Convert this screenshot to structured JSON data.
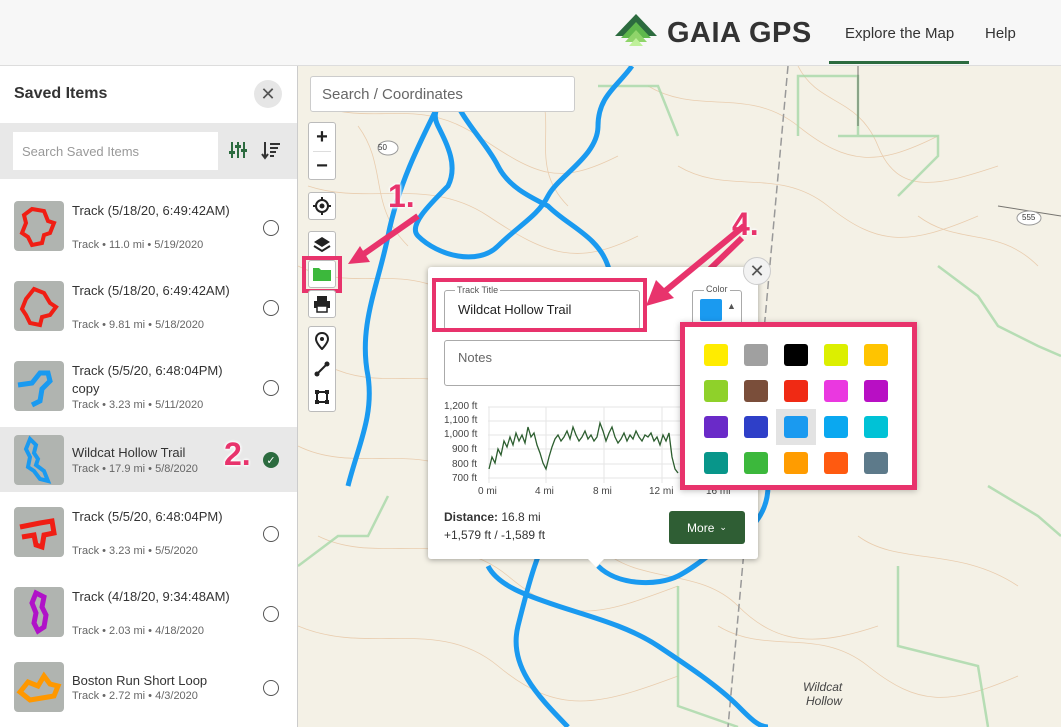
{
  "header": {
    "brand": "GAIA GPS",
    "nav": {
      "explore": "Explore the Map",
      "help": "Help"
    },
    "colors": {
      "brand_green": "#2c6b3f"
    }
  },
  "sidebar": {
    "title": "Saved Items",
    "close_icon": "close-icon",
    "search_placeholder": "Search Saved Items",
    "items": [
      {
        "title": "Track (5/18/20, 6:49:42AM)",
        "meta": "Track • 11.0 mi • 5/19/2020",
        "color": "#f01e14",
        "selected": false
      },
      {
        "title": "Track (5/18/20, 6:49:42AM)",
        "meta": "Track • 9.81 mi • 5/18/2020",
        "color": "#f01e14",
        "selected": false
      },
      {
        "title": "Track (5/5/20, 6:48:04PM) copy",
        "meta": "Track • 3.23 mi • 5/11/2020",
        "color": "#1a9af0",
        "selected": false
      },
      {
        "title": "Wildcat Hollow Trail",
        "meta": "Track • 17.9 mi • 5/8/2020",
        "color": "#1a9af0",
        "selected": true
      },
      {
        "title": "Track (5/5/20, 6:48:04PM)",
        "meta": "Track • 3.23 mi • 5/5/2020",
        "color": "#f01e14",
        "selected": false
      },
      {
        "title": "Track (4/18/20, 9:34:48AM)",
        "meta": "Track • 2.03 mi • 4/18/2020",
        "color": "#b012c8",
        "selected": false
      },
      {
        "title": "Boston Run Short Loop",
        "meta": "Track • 2.72 mi • 4/3/2020",
        "color": "#ff9800",
        "selected": false
      }
    ]
  },
  "map": {
    "search_placeholder": "Search / Coordinates",
    "road_labels": [
      "50",
      "555"
    ],
    "place_labels": [
      "Wildcat",
      "Hollow"
    ],
    "controls": [
      "zoom-in",
      "zoom-out",
      "locate",
      "layers",
      "folder",
      "print",
      "marker",
      "route",
      "area"
    ]
  },
  "annotations": [
    "1.",
    "2.",
    "4."
  ],
  "popup": {
    "title_label": "Track Title",
    "title_value": "Wildcat Hollow Trail",
    "notes_label": "Notes",
    "color_label": "Color",
    "selected_color": "#1a9af0",
    "distance_label": "Distance:",
    "distance_value": "16.8 mi",
    "elevation_gain": "+1,579 ft / -1,589 ft",
    "more_label": "More",
    "profile": {
      "y_ticks": [
        "1,200 ft",
        "1,100 ft",
        "1,000 ft",
        "900 ft",
        "800 ft",
        "700 ft"
      ],
      "x_ticks": [
        "0 mi",
        "4 mi",
        "8 mi",
        "12 mi",
        "16 mi"
      ]
    }
  },
  "palette": {
    "colors": [
      "#ffec00",
      "#a0a0a0",
      "#000000",
      "#dcef00",
      "#ffc400",
      "#8fd12a",
      "#7a4e3a",
      "#f02a14",
      "#ea38e0",
      "#b80fc4",
      "#6a2ac8",
      "#2e3fc8",
      "#1a9af0",
      "#0aa8f0",
      "#00c2d6",
      "#08968a",
      "#3cb83c",
      "#ff9c00",
      "#ff5a10",
      "#5d7a8a"
    ],
    "selected_index": 12
  }
}
